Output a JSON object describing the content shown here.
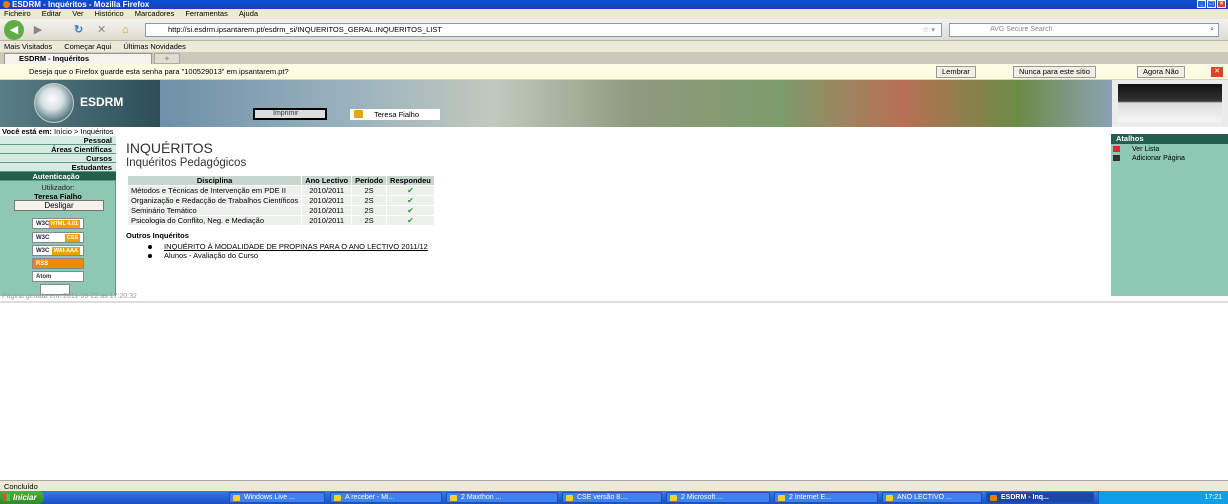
{
  "window": {
    "title": "ESDRM - Inquéritos - Mozilla Firefox"
  },
  "menu": [
    "Ficheiro",
    "Editar",
    "Ver",
    "Histórico",
    "Marcadores",
    "Ferramentas",
    "Ajuda"
  ],
  "nav": {
    "url": "http://si.esdrm.ipsantarem.pt/esdrm_si/INQUERITOS_GERAL.INQUERITOS_LIST",
    "search_placeholder": "AVG Secure Search"
  },
  "bookmarks": [
    "Mais Visitados",
    "Começar Aqui",
    "Últimas Novidades"
  ],
  "tabs": [
    {
      "label": "ESDRM - Inquéritos"
    }
  ],
  "notification": {
    "text": "Deseja que o Firefox guarde esta senha para \"100529013\" em ipsantarem.pt?",
    "btn_remember": "Lembrar",
    "btn_never": "Nunca para este sítio",
    "btn_notnow": "Agora Não"
  },
  "banner": {
    "logo_text": "ESDRM",
    "print_label": "Imprimir",
    "user_name": "Teresa Fialho"
  },
  "breadcrumb": {
    "prefix": "Você está em:",
    "home": "Início",
    "sep": ">",
    "current": "Inquéritos"
  },
  "sidebar": {
    "items": [
      "Pessoal",
      "Áreas Científicas",
      "Cursos",
      "Estudantes",
      "Autenticação"
    ],
    "user_label": "Utilizador:",
    "user_name": "Teresa Fialho",
    "logout": "Desligar",
    "badges": {
      "html": "W3C",
      "html_tag": "HTML 4.01",
      "css": "W3C",
      "css_tag": "CSS",
      "wai": "W3C",
      "wai_tag": "WAI-AAA",
      "rss": "RSS",
      "atom": "Atom"
    }
  },
  "main": {
    "title": "INQUÉRITOS",
    "subtitle": "Inquéritos Pedagógicos",
    "table": {
      "headers": [
        "Disciplina",
        "Ano Lectivo",
        "Período",
        "Respondeu"
      ],
      "rows": [
        [
          "Métodos e Técnicas de Intervenção em PDE II",
          "2010/2011",
          "2S",
          "✔"
        ],
        [
          "Organização e Redacção de Trabalhos Científicos",
          "2010/2011",
          "2S",
          "✔"
        ],
        [
          "Seminário Temático",
          "2010/2011",
          "2S",
          "✔"
        ],
        [
          "Psicologia do Conflito, Neg. e Mediação",
          "2010/2011",
          "2S",
          "✔"
        ]
      ]
    },
    "outros_title": "Outros Inquéritos",
    "outros": [
      "INQUÉRITO À MODALIDADE DE PROPINAS PARA O ANO LECTIVO 2011/12",
      "Alunos - Avaliação do Curso"
    ],
    "generated": "Página gerada em: 2011-09-22 às 17:20:32"
  },
  "right": {
    "title": "Atalhos",
    "items": [
      "Ver Lista",
      "Adicionar Página"
    ]
  },
  "status": {
    "text": "Concluído"
  },
  "taskbar": {
    "start": "Iniciar",
    "items": [
      "Windows Live ...",
      "A receber - Mi...",
      "2 Maxthon ...",
      "CSE versão 8....",
      "2 Microsoft ...",
      "2 Internet E...",
      "ANO LECTIVO ...",
      "ESDRM - Inq..."
    ],
    "clock": "17:21"
  }
}
